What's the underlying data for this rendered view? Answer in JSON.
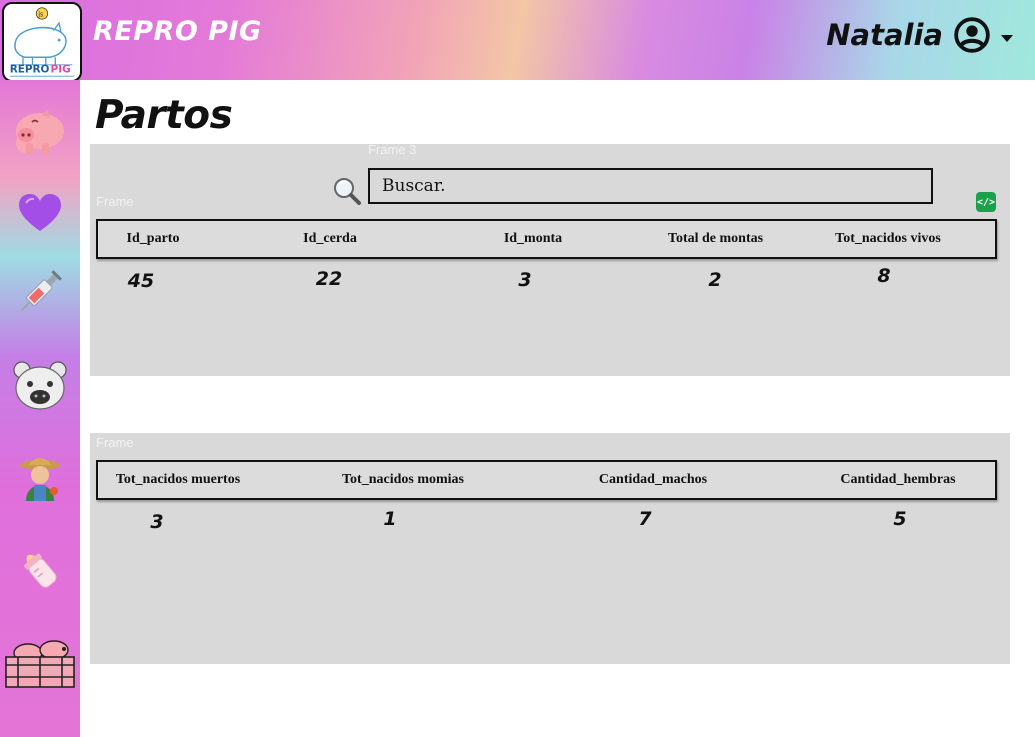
{
  "app": {
    "title": "REPRO PIG",
    "logo_text_main": "REPRO",
    "logo_text_accent": "PIG",
    "logo_badge": "js"
  },
  "user": {
    "name": "Natalia",
    "icon": "user-circle-icon"
  },
  "sidebar": {
    "items": [
      {
        "icon": "pig-face-icon"
      },
      {
        "icon": "purple-heart-icon"
      },
      {
        "icon": "syringe-icon"
      },
      {
        "icon": "piglet-face-icon"
      },
      {
        "icon": "farmer-icon"
      },
      {
        "icon": "baby-bottle-icon"
      },
      {
        "icon": "pig-pen-icon"
      }
    ]
  },
  "page": {
    "title": "Partos"
  },
  "frames": {
    "frame3": "Frame 3",
    "frame_a": "Frame",
    "frame_b": "Frame"
  },
  "search": {
    "placeholder": "Buscar.",
    "icon": "magnifier-icon"
  },
  "code_badge": "</>",
  "table1": {
    "headers": [
      "Id_parto",
      "Id_cerda",
      "Id_monta",
      "Total de montas",
      "Tot_nacidos vivos"
    ],
    "values": [
      "45",
      "22",
      "3",
      "2",
      "8"
    ]
  },
  "table2": {
    "headers": [
      "Tot_nacidos muertos",
      "Tot_nacidos momias",
      "Cantidad_machos",
      "Cantidad_hembras"
    ],
    "values": [
      "3",
      "1",
      "7",
      "5"
    ]
  },
  "colors": {
    "panel": "#d9d9d9",
    "sidebar": "#e475d6",
    "accent_green": "#1aa14c"
  }
}
